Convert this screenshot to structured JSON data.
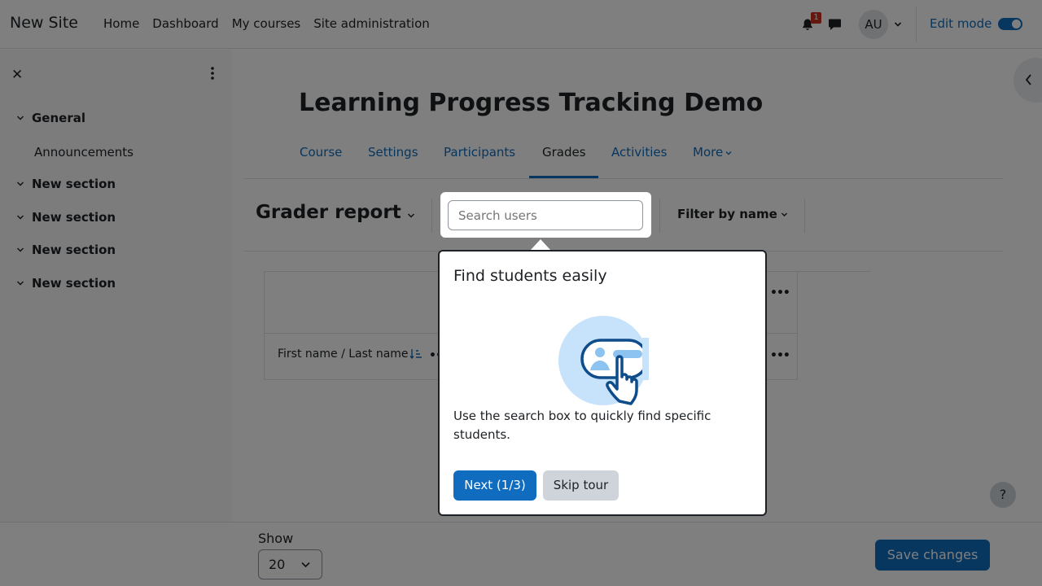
{
  "navbar": {
    "site_name": "New Site",
    "links": [
      "Home",
      "Dashboard",
      "My courses",
      "Site administration"
    ],
    "notification_count": "1",
    "avatar_initials": "AU",
    "edit_mode_label": "Edit mode",
    "edit_mode_on": true
  },
  "drawer": {
    "close_glyph": "✕",
    "sections": [
      {
        "label": "General",
        "items": [
          "Announcements"
        ]
      },
      {
        "label": "New section"
      },
      {
        "label": "New section"
      },
      {
        "label": "New section"
      },
      {
        "label": "New section"
      }
    ]
  },
  "course": {
    "title": "Learning Progress Tracking Demo",
    "tabs": [
      "Course",
      "Settings",
      "Participants",
      "Grades",
      "Activities",
      "More"
    ],
    "active_tab": "Grades"
  },
  "report": {
    "title": "Grader report",
    "search_placeholder": "Search users",
    "filter_label": "Filter by name",
    "column_header": "First name / Last name",
    "actions_glyph": "•••"
  },
  "tour": {
    "title": "Find students easily",
    "body": "Use the search box to quickly find specific students.",
    "next_label": "Next (1/3)",
    "skip_label": "Skip tour"
  },
  "footer": {
    "show_label": "Show",
    "show_value": "20",
    "save_label": "Save changes"
  },
  "help_glyph": "?",
  "colors": {
    "primary": "#0f6cbf",
    "text": "#1d2125",
    "badge": "#ca3120"
  }
}
